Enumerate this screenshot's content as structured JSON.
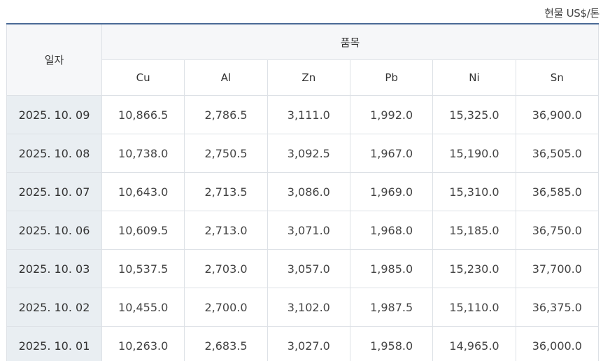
{
  "unit_label": "현물 US$/톤",
  "header": {
    "date_label": "일자",
    "group_label": "품목",
    "metals": [
      "Cu",
      "Al",
      "Zn",
      "Pb",
      "Ni",
      "Sn"
    ]
  },
  "rows": [
    {
      "date": "2025. 10. 09",
      "values": [
        "10,866.5",
        "2,786.5",
        "3,111.0",
        "1,992.0",
        "15,325.0",
        "36,900.0"
      ]
    },
    {
      "date": "2025. 10. 08",
      "values": [
        "10,738.0",
        "2,750.5",
        "3,092.5",
        "1,967.0",
        "15,190.0",
        "36,505.0"
      ]
    },
    {
      "date": "2025. 10. 07",
      "values": [
        "10,643.0",
        "2,713.5",
        "3,086.0",
        "1,969.0",
        "15,310.0",
        "36,585.0"
      ]
    },
    {
      "date": "2025. 10. 06",
      "values": [
        "10,609.5",
        "2,713.0",
        "3,071.0",
        "1,968.0",
        "15,185.0",
        "36,750.0"
      ]
    },
    {
      "date": "2025. 10. 03",
      "values": [
        "10,537.5",
        "2,703.0",
        "3,057.0",
        "1,985.0",
        "15,230.0",
        "37,700.0"
      ]
    },
    {
      "date": "2025. 10. 02",
      "values": [
        "10,455.0",
        "2,700.0",
        "3,102.0",
        "1,987.5",
        "15,110.0",
        "36,375.0"
      ]
    },
    {
      "date": "2025. 10. 01",
      "values": [
        "10,263.0",
        "2,683.5",
        "3,027.0",
        "1,958.0",
        "14,965.0",
        "36,000.0"
      ]
    }
  ]
}
